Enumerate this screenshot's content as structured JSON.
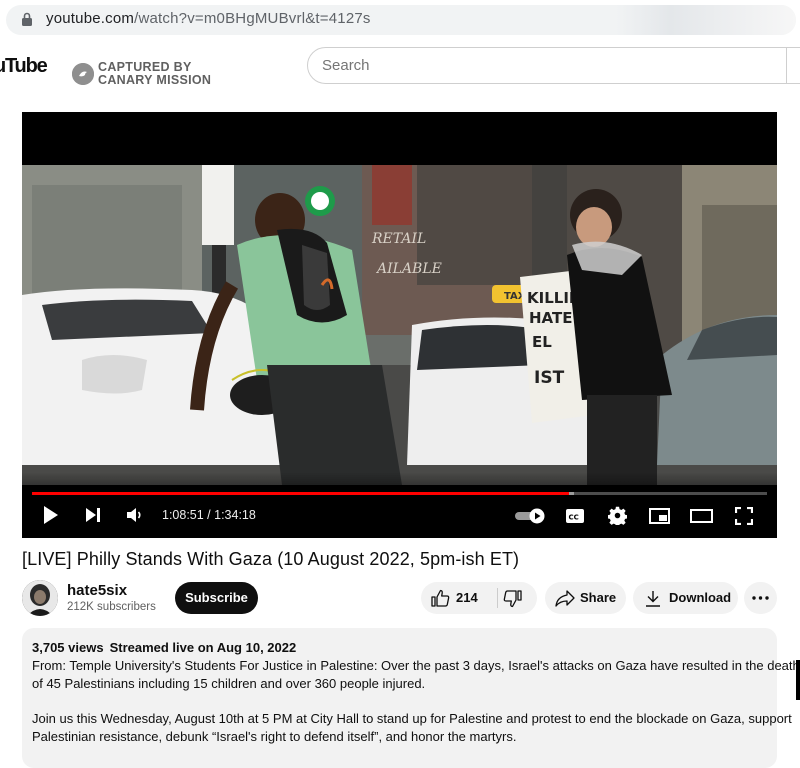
{
  "browser": {
    "url_host": "youtube.com",
    "url_path": "/watch?v=m0BHgMUBvrl&t=4127s"
  },
  "header": {
    "logo_text": "uTube",
    "badge_line1": "CAPTURED BY",
    "badge_line2": "CANARY MISSION",
    "search_placeholder": "Search"
  },
  "player": {
    "current_time": "1:08:51",
    "duration": "1:34:18",
    "time_display": "1:08:51 / 1:34:18",
    "progress_fraction": 0.73,
    "buffered_fraction": 0.738,
    "overlay": {
      "sign_text": "KILLIN HATE EL IST",
      "storefront_text": "RETAIL SPACE AVAILABLE",
      "taxi_text": "TAXI"
    },
    "colors": {
      "progress": "#ff0000"
    }
  },
  "video": {
    "title": "[LIVE] Philly Stands With Gaza (10 August 2022, 5pm-ish ET)",
    "channel_name": "hate5six",
    "subscribers": "212K subscribers",
    "subscribe_label": "Subscribe",
    "like_count": "214",
    "share_label": "Share",
    "download_label": "Download"
  },
  "description": {
    "views": "3,705 views",
    "streamed": "Streamed live on Aug 10, 2022",
    "line1": "From: Temple University's Students For Justice in Palestine: Over the past 3 days, Israel's attacks on Gaza have resulted in the death",
    "line2": "of 45 Palestinians including 15 children and over 360 people injured.",
    "line3": "Join us this Wednesday, August 10th at 5 PM at City Hall to stand up for Palestine and protest to end the blockade on Gaza, support",
    "line4": "Palestinian resistance, debunk “Israel's right to defend itself”, and honor the martyrs."
  }
}
